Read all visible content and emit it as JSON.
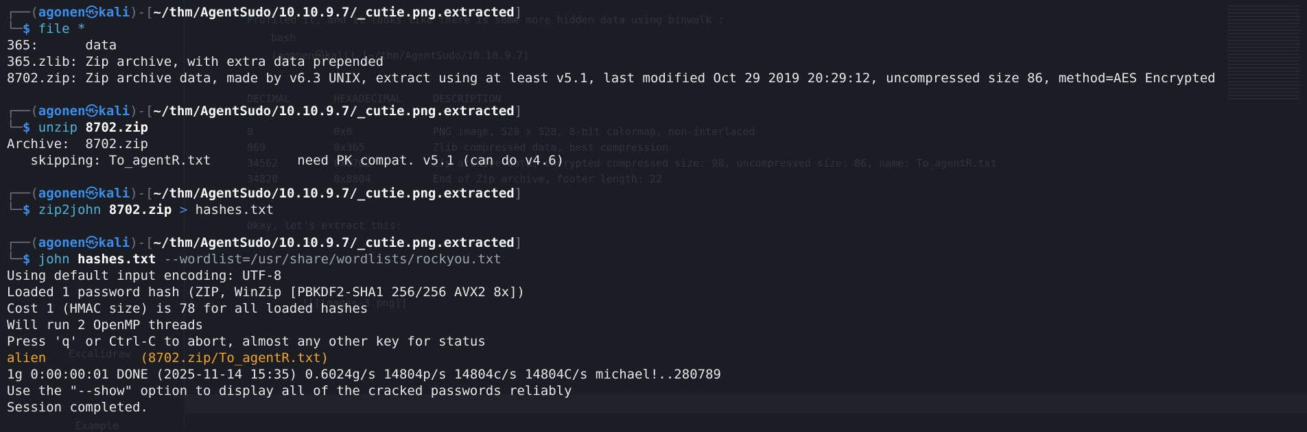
{
  "prompt": {
    "corner_top": "┌──(",
    "corner_bottom": "└─",
    "user": "agonen",
    "at_symbol": "㉿",
    "host": "kali",
    "mid": ")-[",
    "cwd": "~/thm/AgentSudo/10.10.9.7/_cutie.png.extracted",
    "close": "]",
    "dollar": "$"
  },
  "blocks": [
    {
      "command": "file",
      "args_plain": " *",
      "output": [
        "365:      data",
        "365.zlib: Zip archive, with extra data prepended",
        "8702.zip: Zip archive data, made by v6.3 UNIX, extract using at least v5.1, last modified Oct 29 2019 20:29:12, uncompressed size 86, method=AES Encrypted"
      ]
    },
    {
      "command": "unzip",
      "arg_bold": "8702.zip",
      "output": [
        "Archive:  8702.zip",
        "   skipping: To_agentR.txt           need PK compat. v5.1 (can do v4.6)"
      ]
    },
    {
      "command": "zip2john",
      "arg_bold": "8702.zip",
      "redirect": ">",
      "target": "hashes.txt"
    },
    {
      "command": "john",
      "arg_bold": "hashes.txt",
      "option": "--wordlist=/usr/share/wordlists/rockyou.txt",
      "output_before": [
        "Using default input encoding: UTF-8",
        "Loaded 1 password hash (ZIP, WinZip [PBKDF2-SHA1 256/256 AVX2 8x])",
        "Cost 1 (HMAC size) is 78 for all loaded hashes",
        "Will run 2 OpenMP threads",
        "Press 'q' or Ctrl-C to abort, almost any other key for status"
      ],
      "cracked_password": "alien",
      "cracked_spacing": "            ",
      "cracked_source": "(8702.zip/To_agentR.txt)",
      "output_after": [
        "1g 0:00:00:01 DONE (2025-11-14 15:35) 0.6024g/s 14804p/s 14804c/s 14804C/s michael!..280789",
        "Use the \"--show\" option to display all of the cracked passwords reliably",
        "Session completed."
      ]
    }
  ],
  "background_ghost": [
    "Profiled it, and it looks like there is some more hidden data using binwalk :",
    "bash",
    "(agonen㉿kali)-[~/thm/AgentSudo/10.10.9.7]",
    "DECIMAL       HEXADECIMAL     DESCRIPTION",
    "0             0x0             PNG image, 528 x 528, 8-bit colormap, non-interlaced",
    "869           0x365           Zlib compressed data, best compression",
    "34562         0x8702          Zip archive data, encrypted compressed size: 98, uncompressed size: 86, name: To_agentR.txt",
    "34820         0x8804          End of Zip archive, footer length: 22",
    "Okay, let's extract this:",
    "![[images-3.png]]",
    "Excalidraw",
    "Example"
  ],
  "colors": {
    "background": "#1a1d23",
    "prompt_blue": "#3b8eea",
    "command_cyan": "#4fb4d8",
    "password_orange": "#f5a623"
  }
}
